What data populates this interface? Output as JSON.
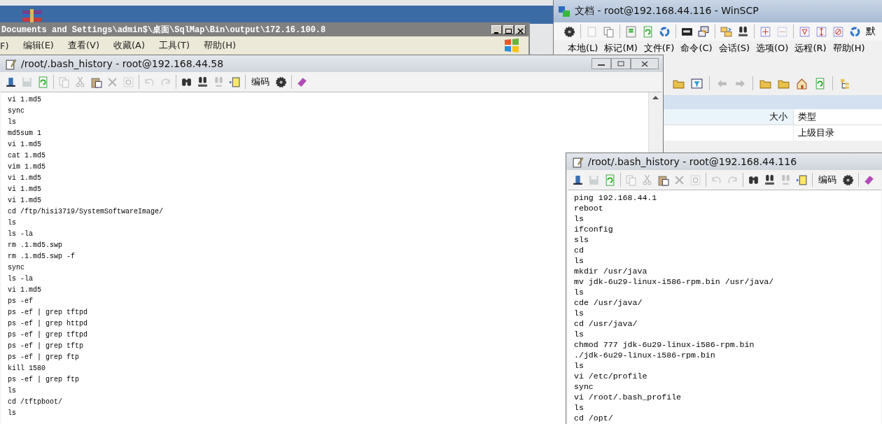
{
  "explorer_window": {
    "title": "Documents and Settings\\admin$\\桌面\\SqlMap\\Bin\\output\\172.16.100.8",
    "menu": [
      "F)",
      "编辑(E)",
      "查看(V)",
      "收藏(A)",
      "工具(T)",
      "帮助(H)"
    ]
  },
  "winscp_window": {
    "title": "文档 - root@192.168.44.116 - WinSCP",
    "toolbar_text": "默",
    "menu": [
      "本地(L)",
      "标记(M)",
      "文件(F)",
      "命令(C)",
      "会话(S)",
      "选项(O)",
      "远程(R)",
      "帮助(H)"
    ],
    "columns": [
      "大小",
      "类型"
    ],
    "rows": [
      {
        "column_2": "上级目录"
      }
    ]
  },
  "editors": [
    {
      "title": "/root/.bash_history - root@192.168.44.58",
      "encoding_button": "编码",
      "lines": [
        "vi 1.md5",
        "sync",
        "ls",
        "md5sum 1",
        "vi 1.md5",
        "cat 1.md5",
        "vim 1.md5",
        "vi 1.md5",
        "vi 1.md5",
        "vi 1.md5",
        "cd /ftp/hisi3719/SystemSoftwareImage/",
        "ls",
        "ls -la",
        "rm .1.md5.swp",
        "rm .1.md5.swp -f",
        "sync",
        "ls -la",
        "vi 1.md5",
        "ps -ef",
        "ps -ef | grep tftpd",
        "ps -ef | grep httpd",
        "ps -ef | grep tftpd",
        "ps -ef | grep tftp",
        "ps -ef | grep ftp",
        "kill 1580",
        "ps -ef | grep ftp",
        "ls",
        "cd /tftpboot/",
        "ls"
      ]
    },
    {
      "title": "/root/.bash_history - root@192.168.44.116",
      "encoding_button": "编码",
      "lines": [
        "ping 192.168.44.1",
        "reboot",
        "ls",
        "ifconfig",
        "sls",
        "cd",
        "ls",
        "mkdir /usr/java",
        "mv jdk-6u29-linux-i586-rpm.bin /usr/java/",
        "ls",
        "cde /usr/java/",
        "ls",
        "cd /usr/java/",
        "ls",
        "chmod 777 jdk-6u29-linux-i586-rpm.bin",
        "./jdk-6u29-linux-i586-rpm.bin",
        "ls",
        "vi /etc/profile",
        "sync",
        "vi /root/.bash_profile",
        "ls",
        "cd /opt/"
      ]
    }
  ]
}
